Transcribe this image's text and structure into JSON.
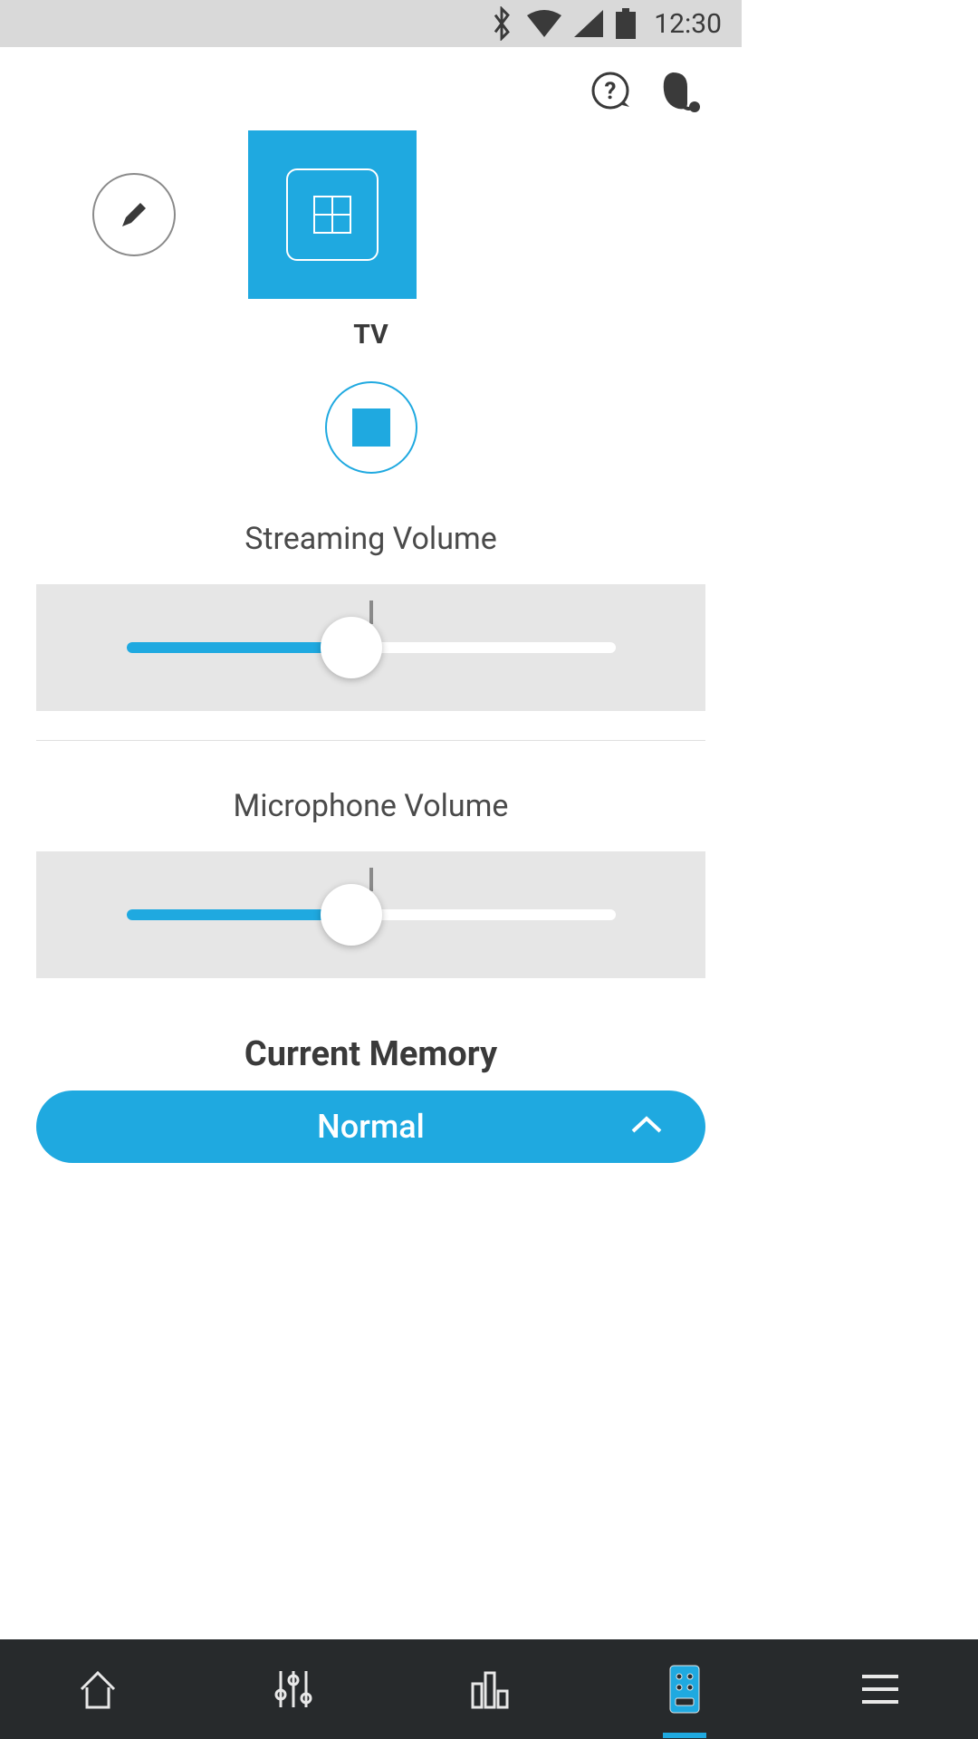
{
  "status": {
    "time": "12:30"
  },
  "program": {
    "label": "TV"
  },
  "sliders": {
    "streaming": {
      "title": "Streaming Volume",
      "value": 46
    },
    "microphone": {
      "title": "Microphone Volume",
      "value": 46
    }
  },
  "memory": {
    "title": "Current Memory",
    "selected": "Normal"
  },
  "colors": {
    "accent": "#1fa9e0"
  }
}
